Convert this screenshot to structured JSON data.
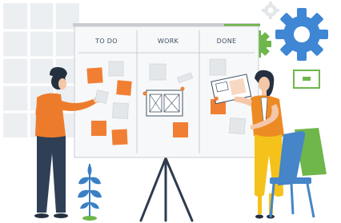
{
  "board": {
    "columns": [
      {
        "title": "TO DO"
      },
      {
        "title": "WORK"
      },
      {
        "title": "DONE"
      }
    ]
  },
  "colors": {
    "window": "#eceff2",
    "board": "#f7f8f9",
    "board_line": "#c8ccd1",
    "note_orange": "#f07f33",
    "note_gray": "#e4e7ea",
    "gear_blue": "#3f86d4",
    "plant_blue": "#3b7fc4",
    "green": "#6fb64b",
    "woman_shirt": "#ec8a24",
    "woman_pants": "#f4c21b",
    "man_shirt": "#ec7c2c",
    "man_pants": "#2f3f56",
    "skin": "#f4c7a8",
    "hair": "#243040",
    "chair_blue": "#4585c8"
  },
  "icons": [
    "gear-icon",
    "plant-icon",
    "chair-icon",
    "easel-stand-icon",
    "monitor-icon"
  ]
}
